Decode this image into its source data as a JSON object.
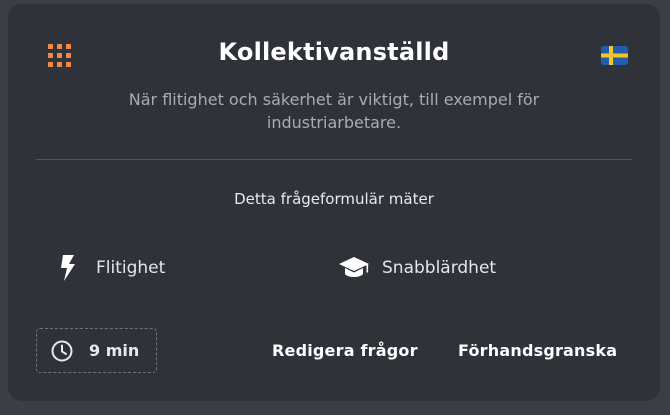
{
  "card": {
    "title": "Kollektivanställd",
    "subtitle": "När flitighet och säkerhet är viktigt, till exempel för industriarbetare.",
    "menu_icon": "grid-icon",
    "language_icon": "swedish-flag-icon"
  },
  "measures": {
    "heading": "Detta frågeformulär mäter",
    "traits": [
      {
        "label": "Flitighet",
        "icon": "lightning-bolt-icon"
      },
      {
        "label": "Snabblärdhet",
        "icon": "graduation-cap-icon"
      }
    ]
  },
  "footer": {
    "duration": "9 min",
    "duration_icon": "clock-icon",
    "edit_label": "Redigera frågor",
    "preview_label": "Förhandsgranska"
  },
  "colors": {
    "background": "#3a3e46",
    "card": "#2f3239",
    "accent": "#f0894a",
    "text": "#ffffff",
    "muted": "#a8acb3"
  }
}
